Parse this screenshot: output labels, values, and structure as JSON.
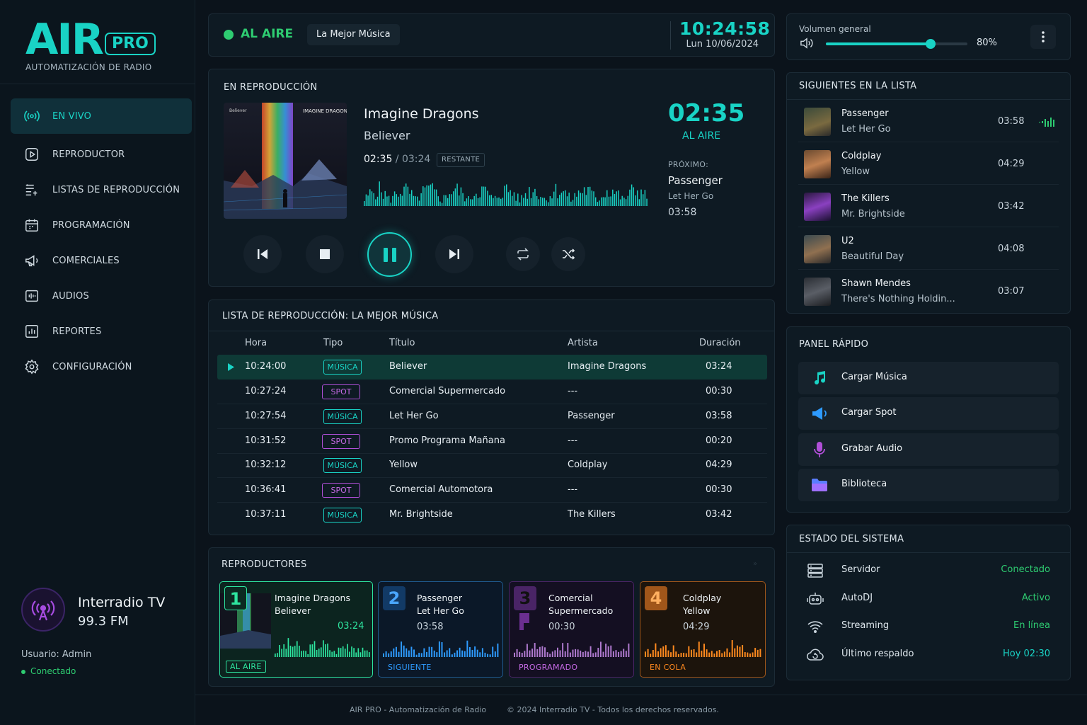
{
  "app": {
    "logo_text": "AIR",
    "logo_badge": "PRO",
    "subtitle": "AUTOMATIZACIÓN DE RADIO",
    "accent": "#19d3c5"
  },
  "nav": {
    "items": [
      {
        "label": "EN VIVO",
        "icon": "broadcast-icon",
        "active": true
      },
      {
        "label": "REPRODUCTOR",
        "icon": "play-square-icon"
      },
      {
        "label": "LISTAS DE REPRODUCCIÓN",
        "icon": "playlist-icon"
      },
      {
        "label": "PROGRAMACIÓN",
        "icon": "calendar-icon"
      },
      {
        "label": "COMERCIALES",
        "icon": "megaphone-icon"
      },
      {
        "label": "AUDIOS",
        "icon": "audio-file-icon"
      },
      {
        "label": "REPORTES",
        "icon": "report-chart-icon"
      },
      {
        "label": "CONFIGURACIÓN",
        "icon": "gear-icon"
      }
    ]
  },
  "station": {
    "name": "Interradio TV",
    "frequency": "99.3 FM",
    "user": "Usuario: Admin",
    "status": "Conectado"
  },
  "topbar": {
    "on_air_label": "AL AIRE",
    "program": "La Mejor Música",
    "clock": "10:24:58",
    "date": "Lun 10/06/2024"
  },
  "volume": {
    "label": "Volumen general",
    "value_text": "80%",
    "level": 0.74
  },
  "now_playing": {
    "section_title": "EN REPRODUCCIÓN",
    "artist": "Imagine Dragons",
    "title": "Believer",
    "elapsed": "02:35",
    "separator": " / ",
    "total": "03:24",
    "remaining_badge": "RESTANTE",
    "big_time": "02:35",
    "on_air": "AL AIRE",
    "next_label": "PRÓXIMO:",
    "next_artist": "Passenger",
    "next_title": "Let Her Go",
    "next_duration": "03:58",
    "album_text_1": "Believer",
    "album_text_2": "IMAGINE DRAGONS"
  },
  "playlist": {
    "title": "LISTA DE REPRODUCCIÓN: LA MEJOR MÚSICA",
    "columns": [
      "Hora",
      "Tipo",
      "Título",
      "Artista",
      "Duración"
    ],
    "rows": [
      {
        "hora": "10:24:00",
        "tipo": "MÚSICA",
        "titulo": "Believer",
        "artista": "Imagine Dragons",
        "duracion": "03:24",
        "playing": true
      },
      {
        "hora": "10:27:24",
        "tipo": "SPOT",
        "titulo": "Comercial Supermercado",
        "artista": "---",
        "duracion": "00:30"
      },
      {
        "hora": "10:27:54",
        "tipo": "MÚSICA",
        "titulo": "Let Her Go",
        "artista": "Passenger",
        "duracion": "03:58"
      },
      {
        "hora": "10:31:52",
        "tipo": "SPOT",
        "titulo": "Promo Programa Mañana",
        "artista": "---",
        "duracion": "00:20"
      },
      {
        "hora": "10:32:12",
        "tipo": "MÚSICA",
        "titulo": "Yellow",
        "artista": "Coldplay",
        "duracion": "04:29"
      },
      {
        "hora": "10:36:41",
        "tipo": "SPOT",
        "titulo": "Comercial Automotora",
        "artista": "---",
        "duracion": "00:30"
      },
      {
        "hora": "10:37:11",
        "tipo": "MÚSICA",
        "titulo": "Mr. Brightside",
        "artista": "The Killers",
        "duracion": "03:42"
      }
    ]
  },
  "decks": {
    "title": "REPRODUCTORES",
    "items": [
      {
        "num": "1",
        "line1": "Imagine Dragons",
        "line2": "Believer",
        "duration": "03:24",
        "status": "AL AIRE",
        "color": "#2ee6a0"
      },
      {
        "num": "2",
        "line1": "Passenger",
        "line2": "Let Her Go",
        "duration": "03:58",
        "status": "SIGUIENTE",
        "color": "#2e9bff"
      },
      {
        "num": "3",
        "line1": "Comercial",
        "line2": "Supermercado",
        "duration": "00:30",
        "status": "PROGRAMADO",
        "color": "#b04fd8"
      },
      {
        "num": "4",
        "line1": "Coldplay",
        "line2": "Yellow",
        "duration": "04:29",
        "status": "EN COLA",
        "color": "#ff8a1f"
      }
    ]
  },
  "queue": {
    "title": "SIGUIENTES EN LA LISTA",
    "items": [
      {
        "artist": "Passenger",
        "title": "Let Her Go",
        "duration": "03:58"
      },
      {
        "artist": "Coldplay",
        "title": "Yellow",
        "duration": "04:29"
      },
      {
        "artist": "The Killers",
        "title": "Mr. Brightside",
        "duration": "03:42"
      },
      {
        "artist": "U2",
        "title": "Beautiful Day",
        "duration": "04:08"
      },
      {
        "artist": "Shawn Mendes",
        "title": "There's Nothing Holdin...",
        "duration": "03:07"
      }
    ]
  },
  "quick_panel": {
    "title": "PANEL RÁPIDO",
    "items": [
      {
        "label": "Cargar Música",
        "icon": "music-note-icon"
      },
      {
        "label": "Cargar Spot",
        "icon": "megaphone-icon"
      },
      {
        "label": "Grabar Audio",
        "icon": "microphone-icon"
      },
      {
        "label": "Biblioteca",
        "icon": "folder-icon"
      }
    ]
  },
  "system": {
    "title": "ESTADO DEL SISTEMA",
    "items": [
      {
        "label": "Servidor",
        "value": "Conectado",
        "color": "#2ecc71",
        "icon": "server-icon"
      },
      {
        "label": "AutoDJ",
        "value": "Activo",
        "color": "#2ecc71",
        "icon": "robot-icon"
      },
      {
        "label": "Streaming",
        "value": "En línea",
        "color": "#2ecc71",
        "icon": "wifi-icon"
      },
      {
        "label": "Último respaldo",
        "value": "Hoy 02:30",
        "color": "#19d3c5",
        "icon": "cloud-backup-icon"
      }
    ]
  },
  "footer": {
    "left": "AIR PRO - Automatización de Radio",
    "right": "© 2024 Interradio TV - Todos los derechos reservados."
  }
}
